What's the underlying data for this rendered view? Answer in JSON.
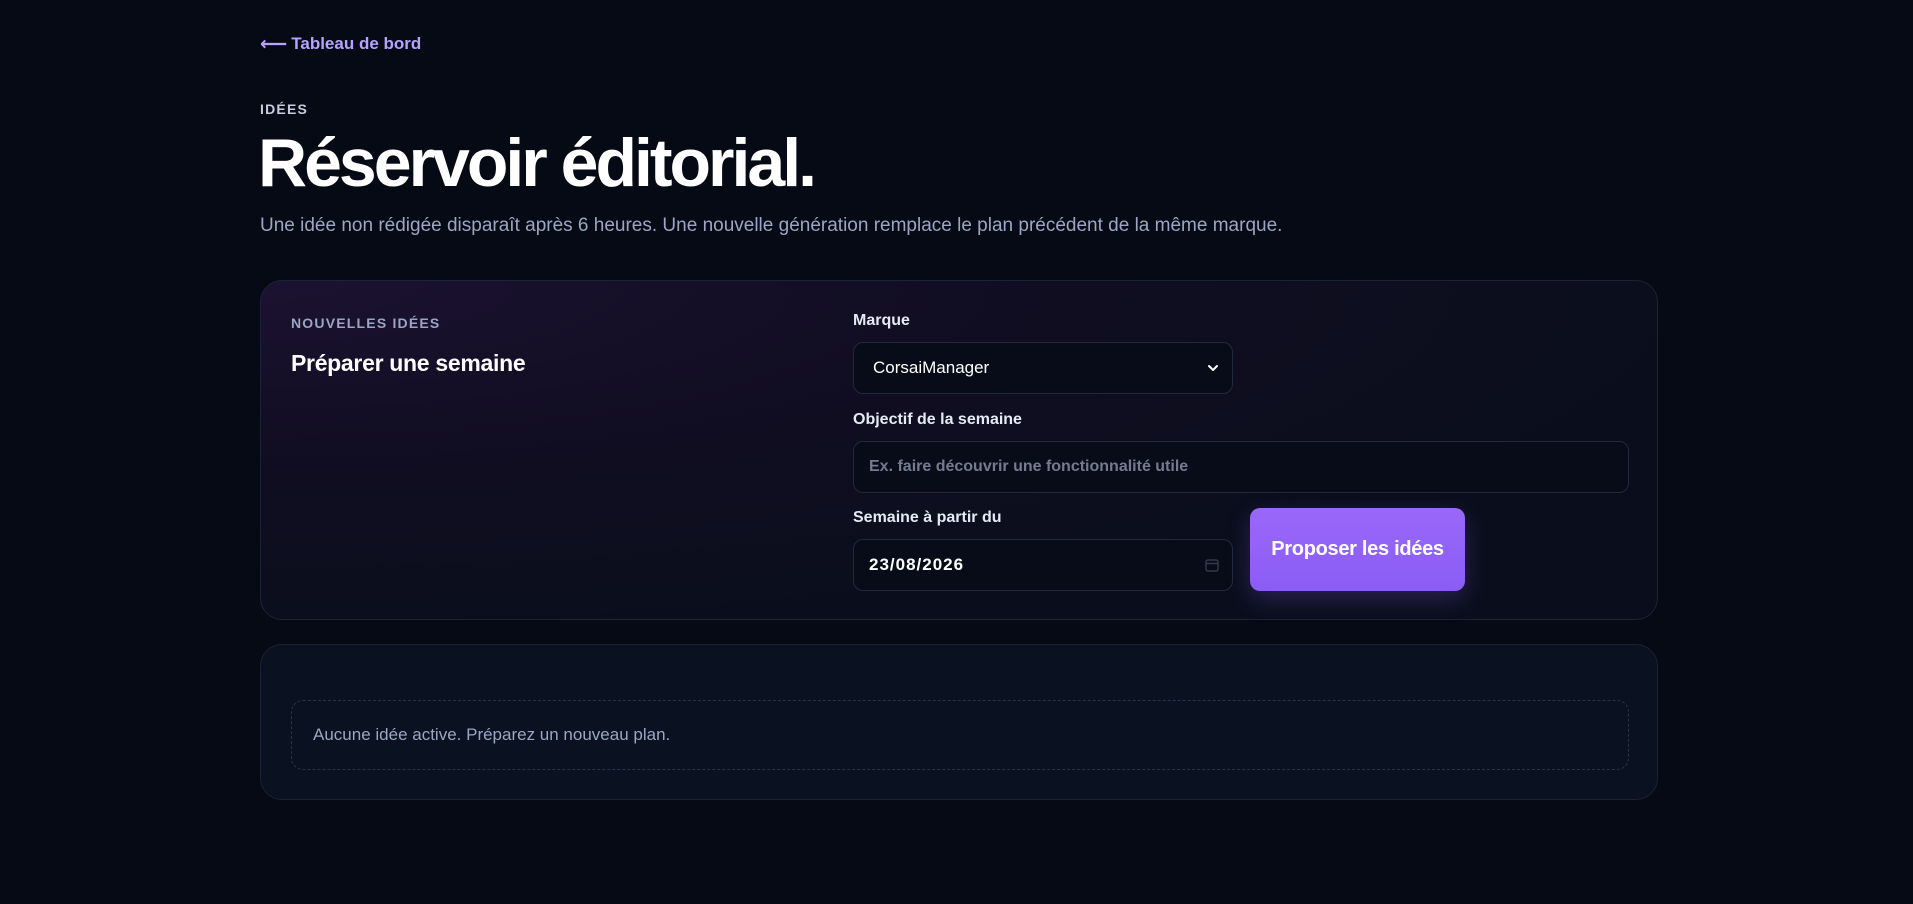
{
  "nav": {
    "back_arrow": "⟵",
    "back_label": "Tableau de bord"
  },
  "header": {
    "eyebrow": "IDÉES",
    "title": "Réservoir éditorial.",
    "subtitle": "Une idée non rédigée disparaît après 6 heures. Une nouvelle génération remplace le plan précédent de la même marque."
  },
  "form": {
    "section_label": "NOUVELLES IDÉES",
    "section_title": "Préparer une semaine",
    "brand_label": "Marque",
    "brand_value": "CorsaiManager",
    "objective_label": "Objectif de la semaine",
    "objective_value": "",
    "objective_placeholder": "Ex. faire découvrir une fonctionnalité utile",
    "week_label": "Semaine à partir du",
    "week_value": "23/08/2026",
    "submit_label": "Proposer les idées"
  },
  "ideas": {
    "empty_message": "Aucune idée active. Préparez un nouveau plan."
  },
  "colors": {
    "background": "#060a14",
    "accent": "#8b5cf6",
    "link": "#b7a3ff",
    "muted_text": "#9aa6c3"
  }
}
